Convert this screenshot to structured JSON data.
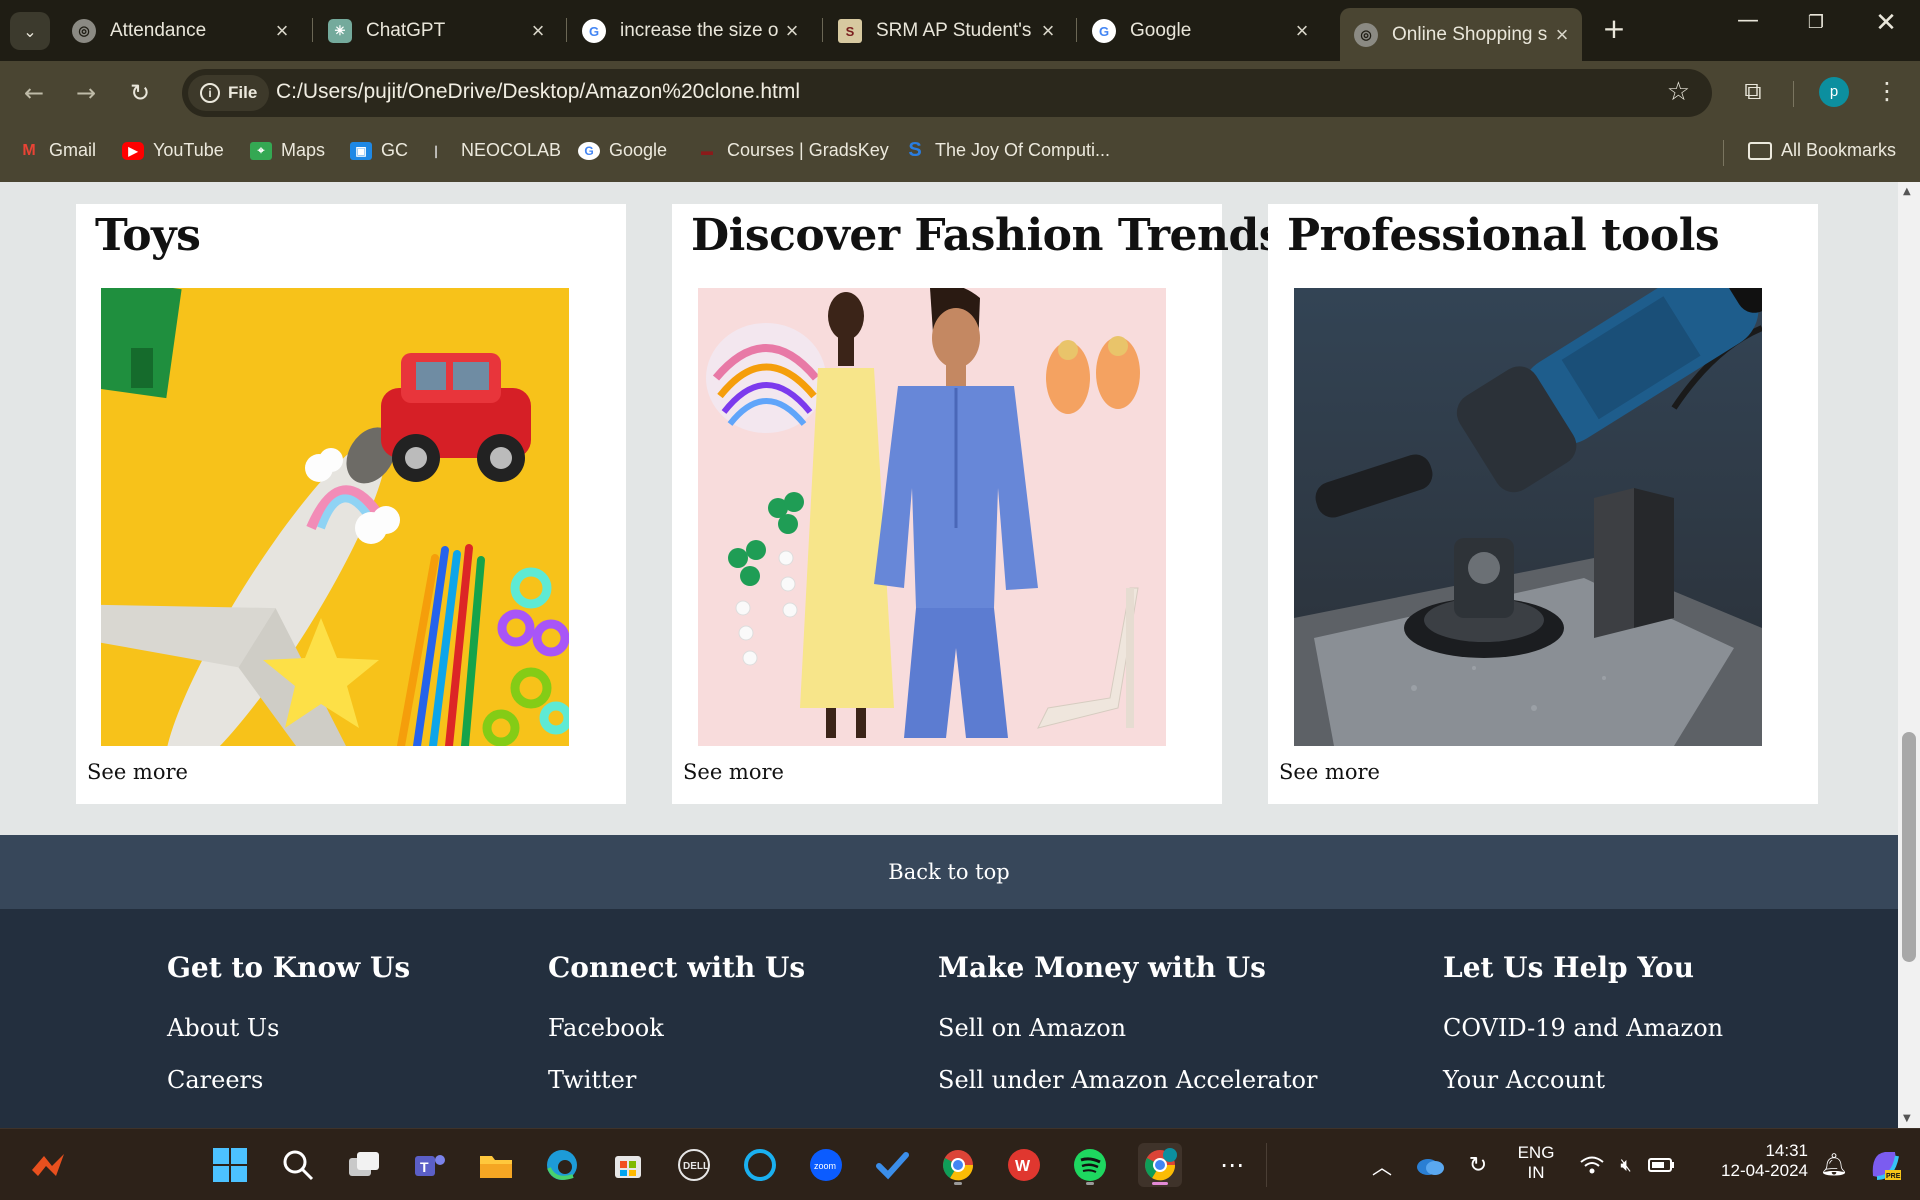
{
  "browser": {
    "tabs": [
      {
        "title": "Attendance",
        "icon": "globe-icon"
      },
      {
        "title": "ChatGPT",
        "icon": "chatgpt-icon"
      },
      {
        "title": "increase the size o",
        "icon": "google-icon"
      },
      {
        "title": "SRM AP Student's",
        "icon": "srm-icon"
      },
      {
        "title": "Google",
        "icon": "google-icon"
      },
      {
        "title": "Online Shopping s",
        "icon": "globe-icon",
        "active": true
      }
    ],
    "address": {
      "chip_label": "File",
      "url": "C:/Users/pujit/OneDrive/Desktop/Amazon%20clone.html"
    },
    "profile_initial": "p",
    "bookmarks": [
      {
        "label": "Gmail",
        "icon": "gmail-icon"
      },
      {
        "label": "YouTube",
        "icon": "youtube-icon"
      },
      {
        "label": "Maps",
        "icon": "maps-icon"
      },
      {
        "label": "GC",
        "icon": "classroom-icon"
      },
      {
        "label": "NEOCOLAB",
        "icon": "neocolab-icon"
      },
      {
        "label": "Google",
        "icon": "google-icon"
      },
      {
        "label": "Courses | GradsKey",
        "icon": "gradskey-icon"
      },
      {
        "label": "The Joy Of Computi...",
        "icon": "swayam-icon"
      }
    ],
    "all_bookmarks_label": "All Bookmarks"
  },
  "page": {
    "cards": [
      {
        "title": "Toys",
        "link": "See more",
        "image": "toys-image"
      },
      {
        "title": "Discover Fashion Trends",
        "link": "See more",
        "image": "fashion-image"
      },
      {
        "title": "Professional tools",
        "link": "See more",
        "image": "angle-grinder-image"
      }
    ],
    "back_to_top": "Back to top",
    "footer": {
      "columns": [
        {
          "heading": "Get to Know Us",
          "links": [
            "About Us",
            "Careers"
          ]
        },
        {
          "heading": "Connect with Us",
          "links": [
            "Facebook",
            "Twitter"
          ]
        },
        {
          "heading": "Make Money with Us",
          "links": [
            "Sell on Amazon",
            "Sell under Amazon Accelerator"
          ]
        },
        {
          "heading": "Let Us Help You",
          "links": [
            "COVID-19 and Amazon",
            "Your Account"
          ]
        }
      ]
    },
    "colors": {
      "page_bg": "#e3e6e6",
      "back_to_top_bg": "#37475a",
      "footer_bg": "#232f3e"
    }
  },
  "taskbar": {
    "language": "ENG",
    "region": "IN",
    "time": "14:31",
    "date": "12-04-2024",
    "apps": [
      "start-icon",
      "search-icon",
      "task-view-icon",
      "teams-icon",
      "file-explorer-icon",
      "edge-icon",
      "store-icon",
      "dell-icon",
      "alexa-icon",
      "zoom-icon",
      "todo-icon",
      "chrome-icon",
      "wps-icon",
      "spotify-icon",
      "chrome-profile-icon",
      "more-icon"
    ]
  }
}
